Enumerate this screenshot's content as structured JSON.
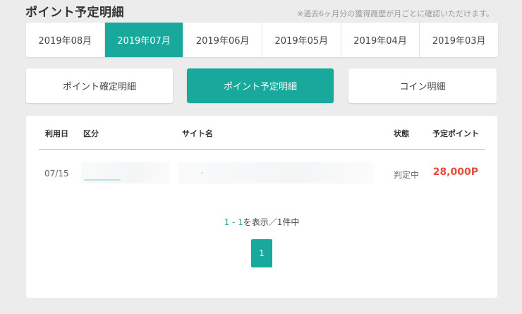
{
  "page": {
    "title": "ポイント予定明細",
    "note": "※過去6ヶ月分の獲得履歴が月ごとに確認いただけます。"
  },
  "month_tabs": [
    {
      "label": "2019年08月",
      "active": false
    },
    {
      "label": "2019年07月",
      "active": true
    },
    {
      "label": "2019年06月",
      "active": false
    },
    {
      "label": "2019年05月",
      "active": false
    },
    {
      "label": "2019年04月",
      "active": false
    },
    {
      "label": "2019年03月",
      "active": false
    }
  ],
  "type_buttons": [
    {
      "label": "ポイント確定明細",
      "active": false
    },
    {
      "label": "ポイント予定明細",
      "active": true
    },
    {
      "label": "コイン明細",
      "active": false
    }
  ],
  "table": {
    "headers": {
      "date": "利用日",
      "category": "区分",
      "site": "サイト名",
      "status": "状態",
      "points": "予定ポイント"
    },
    "rows": [
      {
        "date": "07/15",
        "category": "",
        "site": "",
        "status": "判定中",
        "points": "28,000P"
      }
    ]
  },
  "pagination": {
    "range": "1 - 1",
    "summary_suffix": "を表示／1件中",
    "current_page": "1"
  },
  "colors": {
    "accent": "#18a99c",
    "points": "#e84c3d",
    "background": "#ececec"
  }
}
